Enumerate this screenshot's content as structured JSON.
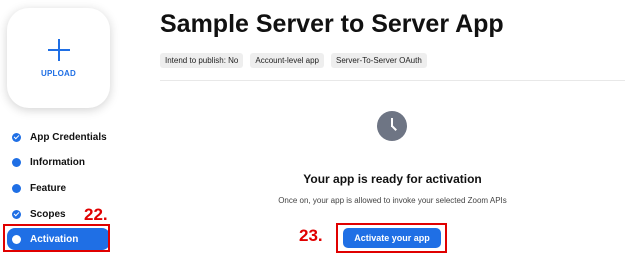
{
  "upload": {
    "label": "UPLOAD"
  },
  "nav": {
    "items": [
      {
        "label": "App Credentials",
        "state": "completed"
      },
      {
        "label": "Information",
        "state": "pending"
      },
      {
        "label": "Feature",
        "state": "pending"
      },
      {
        "label": "Scopes",
        "state": "completed"
      },
      {
        "label": "Activation",
        "state": "active"
      }
    ]
  },
  "annotations": {
    "step_nav": "22.",
    "step_button": "23."
  },
  "app": {
    "title": "Sample Server to Server App",
    "badges": [
      "Intend to publish: No",
      "Account-level app",
      "Server-To-Server OAuth"
    ]
  },
  "activation": {
    "icon": "clock-icon",
    "heading": "Your app is ready for activation",
    "subtext": "Once on, your app is allowed to invoke your selected Zoom APIs",
    "button_label": "Activate your app"
  },
  "colors": {
    "accent": "#1f6fe5",
    "annotation": "#e00000",
    "badge_bg": "#eeeeee"
  }
}
